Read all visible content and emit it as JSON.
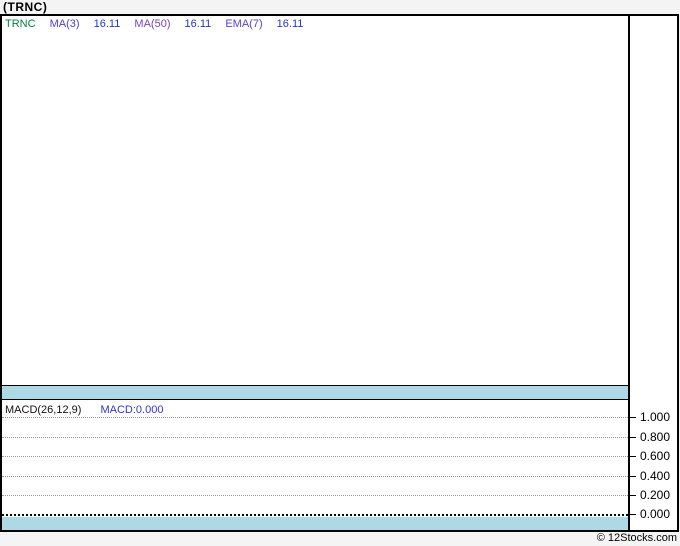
{
  "page": {
    "title": "(TRNC)",
    "copyright": "© 12Stocks.com"
  },
  "legend": {
    "ticker": "TRNC",
    "ticker_color": "#00803d",
    "value_color": "#2236cc",
    "items": [
      {
        "label": "MA(3)",
        "value": "16.11",
        "label_color": "#4b3fd0"
      },
      {
        "label": "MA(50)",
        "value": "16.11",
        "label_color": "#7c3fbd"
      },
      {
        "label": "EMA(7)",
        "value": "16.11",
        "label_color": "#5a3fcf"
      }
    ]
  },
  "macd": {
    "label": "MACD(26,12,9)",
    "value_label": "MACD:0.000",
    "value_color": "#3333cc",
    "axis_ticks": [
      "1.000",
      "0.800",
      "0.600",
      "0.400",
      "0.200",
      "0.000"
    ]
  },
  "colors": {
    "band": "#add8e6",
    "grid": "#999999",
    "zero_line": "#000000",
    "border": "#000000",
    "page_bg": "#f4f4f4",
    "chart_bg": "#ffffff"
  },
  "chart_data": [
    {
      "type": "line",
      "title": "(TRNC)",
      "legend_position": "top-left",
      "grid": false,
      "series": [
        {
          "name": "TRNC",
          "values": []
        },
        {
          "name": "MA(3)",
          "values": [
            16.11
          ]
        },
        {
          "name": "MA(50)",
          "values": [
            16.11
          ]
        },
        {
          "name": "EMA(7)",
          "values": [
            16.11
          ]
        }
      ],
      "note": "price panel is empty - no candles or lines plotted"
    },
    {
      "type": "line",
      "title": "MACD(26,12,9)",
      "legend_position": "top-left",
      "grid": true,
      "ylim": [
        0.0,
        1.0
      ],
      "yticks": [
        1.0,
        0.8,
        0.6,
        0.4,
        0.2,
        0.0
      ],
      "series": [
        {
          "name": "MACD",
          "values": [
            0.0
          ]
        }
      ],
      "note": "MACD panel is empty - current MACD value 0.000"
    }
  ]
}
